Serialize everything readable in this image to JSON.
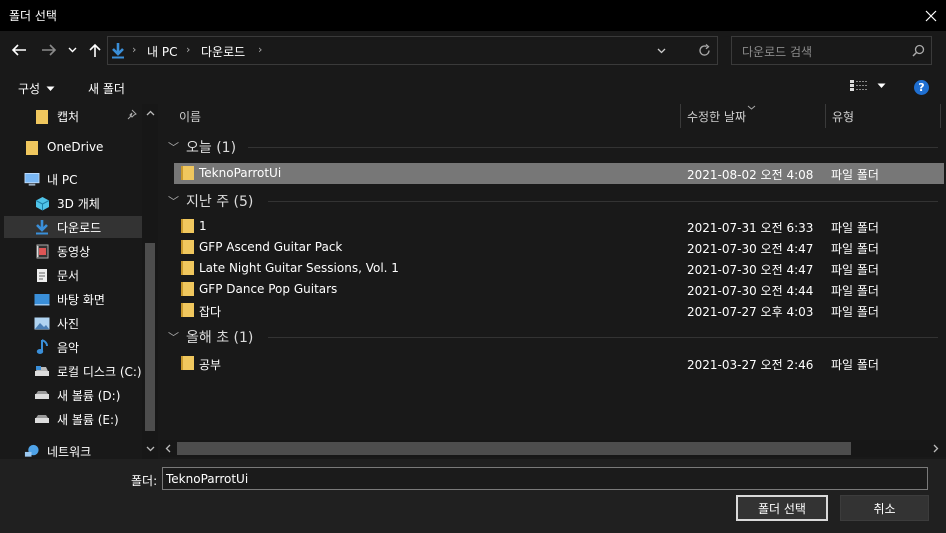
{
  "window": {
    "title": "폴더 선택"
  },
  "address": {
    "segments": [
      "내 PC",
      "다운로드"
    ]
  },
  "search": {
    "placeholder": "다운로드 검색"
  },
  "toolbar": {
    "organize_label": "구성",
    "new_folder_label": "새 폴더"
  },
  "nav": {
    "items": [
      {
        "label": "캡처",
        "icon": "folder-icon"
      },
      {
        "label": "OneDrive",
        "icon": "folder-icon"
      },
      {
        "label": "내 PC",
        "icon": "pc-icon"
      },
      {
        "label": "3D 개체",
        "icon": "3d-objects-icon"
      },
      {
        "label": "다운로드",
        "icon": "download-icon"
      },
      {
        "label": "동영상",
        "icon": "video-icon"
      },
      {
        "label": "문서",
        "icon": "document-icon"
      },
      {
        "label": "바탕 화면",
        "icon": "desktop-icon"
      },
      {
        "label": "사진",
        "icon": "pictures-icon"
      },
      {
        "label": "음악",
        "icon": "music-icon"
      },
      {
        "label": "로컬 디스크 (C:)",
        "icon": "drive-icon"
      },
      {
        "label": "새 볼륨 (D:)",
        "icon": "drive-icon"
      },
      {
        "label": "새 볼륨 (E:)",
        "icon": "drive-icon"
      },
      {
        "label": "네트워크",
        "icon": "network-icon"
      }
    ]
  },
  "columns": {
    "name": "이름",
    "modified": "수정한 날짜",
    "type": "유형"
  },
  "groups": [
    {
      "label": "오늘 (1)",
      "rows": [
        {
          "name": "TeknoParrotUi",
          "date": "2021-08-02 오전 4:08",
          "type": "파일 폴더",
          "selected": true
        }
      ]
    },
    {
      "label": "지난 주 (5)",
      "rows": [
        {
          "name": "1",
          "date": "2021-07-31 오전 6:33",
          "type": "파일 폴더"
        },
        {
          "name": "GFP Ascend Guitar Pack",
          "date": "2021-07-30 오전 4:47",
          "type": "파일 폴더"
        },
        {
          "name": "Late Night Guitar Sessions, Vol. 1",
          "date": "2021-07-30 오전 4:47",
          "type": "파일 폴더"
        },
        {
          "name": "GFP Dance Pop Guitars",
          "date": "2021-07-30 오전 4:44",
          "type": "파일 폴더"
        },
        {
          "name": "잡다",
          "date": "2021-07-27 오후 4:03",
          "type": "파일 폴더"
        }
      ]
    },
    {
      "label": "올해 초 (1)",
      "rows": [
        {
          "name": "공부",
          "date": "2021-03-27 오전 2:46",
          "type": "파일 폴더"
        }
      ]
    }
  ],
  "footer": {
    "folder_label": "폴더:",
    "folder_value": "TeknoParrotUi",
    "select_label": "폴더 선택",
    "cancel_label": "취소"
  },
  "colors": {
    "folder": "#f0c75e",
    "accent_blue": "#3a8fd9",
    "selected_row": "#777777",
    "background": "#191919"
  }
}
